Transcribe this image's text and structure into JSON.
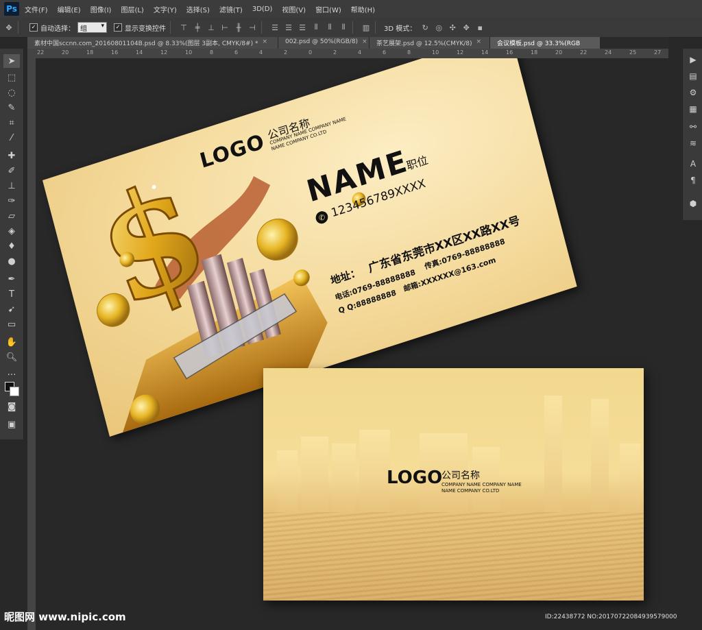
{
  "app": {
    "logo": "Ps"
  },
  "menu": [
    "文件(F)",
    "编辑(E)",
    "图像(I)",
    "图层(L)",
    "文字(Y)",
    "选择(S)",
    "滤镜(T)",
    "3D(D)",
    "视图(V)",
    "窗口(W)",
    "帮助(H)"
  ],
  "options": {
    "auto_select_label": "自动选择：",
    "auto_select_value": "组",
    "show_transform_label": "显示变换控件",
    "mode_3d_label": "3D 模式："
  },
  "tabs": [
    {
      "label": "素材中国sccnn.com_20160801104B.psd @ 8.33%(图层 3副本, CMYK/8#) *",
      "active": false
    },
    {
      "label": "002.psd @ 50%(RGB/8)",
      "active": false
    },
    {
      "label": "茶艺展架.psd @ 12.5%(CMYK/8)",
      "active": false
    },
    {
      "label": "会议模板.psd @ 33.3%(RGB",
      "active": true
    }
  ],
  "ruler": [
    "22",
    "20",
    "18",
    "16",
    "14",
    "12",
    "10",
    "8",
    "6",
    "4",
    "2",
    "0",
    "2",
    "4",
    "6",
    "8",
    "10",
    "12",
    "14",
    "16",
    "18",
    "20",
    "22",
    "24",
    "25",
    "27"
  ],
  "front_card": {
    "logo": "LOGO",
    "company_name": "公司名称",
    "company_en_1": "COMPANY NAME COMPANY NAME",
    "company_en_2": "NAME COMPANY CO.LTD",
    "name": "NAME",
    "position": "职位",
    "mobile": "123456789XXXX",
    "address_label": "地址：",
    "address": "广东省东莞市XX区XX路XX号",
    "phone": "电话:0769-88888888",
    "fax": "传真:0769-88888888",
    "qq": "Q Q:88888888",
    "email": "邮箱:XXXXXX@163.com"
  },
  "back_card": {
    "logo": "LOGO",
    "company_name": "公司名称",
    "company_en_1": "COMPANY NAME COMPANY NAME",
    "company_en_2": "NAME COMPANY CO.LTD"
  },
  "watermark": {
    "left": "昵图网 www.nipic.com",
    "right": "ID:22438772 NO:20170722084939579000"
  },
  "colors": {
    "gold": "#e6b422",
    "card_bg": "#f4d99a",
    "ui_dark": "#282828"
  }
}
